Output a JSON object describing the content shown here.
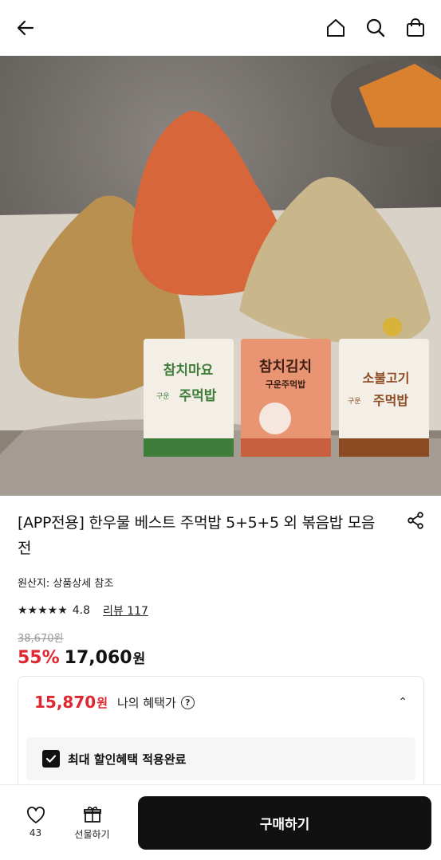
{
  "header": {
    "back_icon": "arrow-left-icon",
    "home_icon": "home-icon",
    "search_icon": "search-icon",
    "bag_icon": "shopping-bag-icon"
  },
  "hero": {
    "packages": [
      {
        "line1": "참치마요",
        "line2": "주먹밥",
        "tag": "구운"
      },
      {
        "line1": "참치김치",
        "line2": "구운주먹밥"
      },
      {
        "line1": "소불고기",
        "line2": "주먹밥",
        "tag": "구운"
      }
    ]
  },
  "product": {
    "title": "[APP전용] 한우물 베스트 주먹밥 5+5+5 외 볶음밥 모음전",
    "origin": "원산지: 상품상세 참조",
    "stars": "★★★★★",
    "rating": "4.8",
    "reviews": "리뷰 117",
    "original_price": "38,670원",
    "discount": "55%",
    "price": "17,060",
    "price_unit": "원"
  },
  "benefit": {
    "price": "15,870",
    "unit": "원",
    "label": "나의 혜택가",
    "help": "?",
    "chevron": "⌃",
    "checkbox_label": "최대 할인혜택 적용완료"
  },
  "bottom": {
    "like_count": "43",
    "gift_label": "선물하기",
    "buy_label": "구매하기"
  },
  "colors": {
    "accent": "#e0262e",
    "dark": "#111111"
  }
}
